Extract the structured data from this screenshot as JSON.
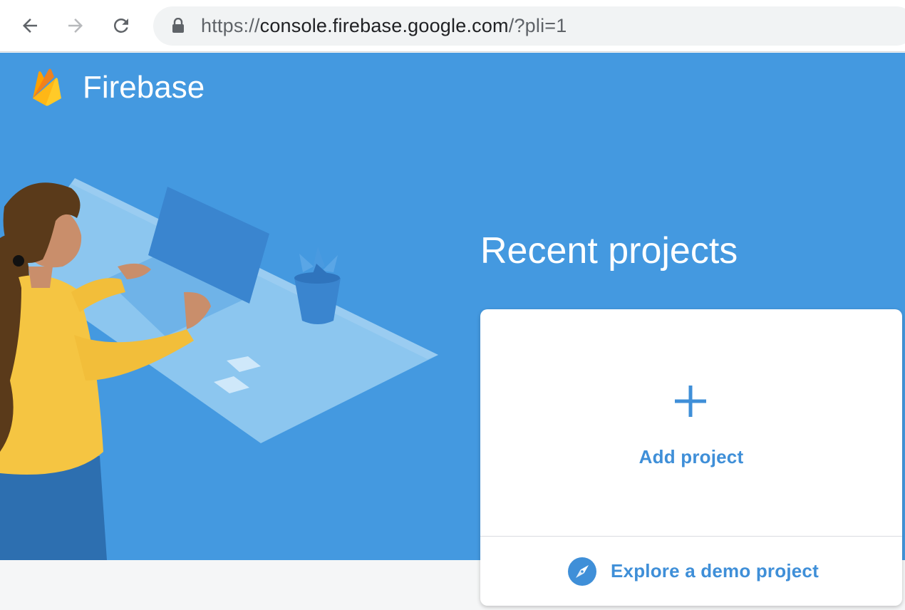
{
  "browser": {
    "url_scheme": "https://",
    "url_host": "console.firebase.google.com",
    "url_path": "/?pli=1"
  },
  "brand": {
    "name": "Firebase",
    "logo_icon": "firebase-flame-icon"
  },
  "main": {
    "title": "Recent projects",
    "add_project_label": "Add project",
    "add_project_icon": "plus-icon",
    "demo_label": "Explore a demo project",
    "demo_icon": "compass-icon"
  },
  "colors": {
    "hero_background": "#4499e0",
    "accent_text": "#3f8fd8",
    "card_background": "#ffffff",
    "page_background": "#f5f6f7"
  }
}
